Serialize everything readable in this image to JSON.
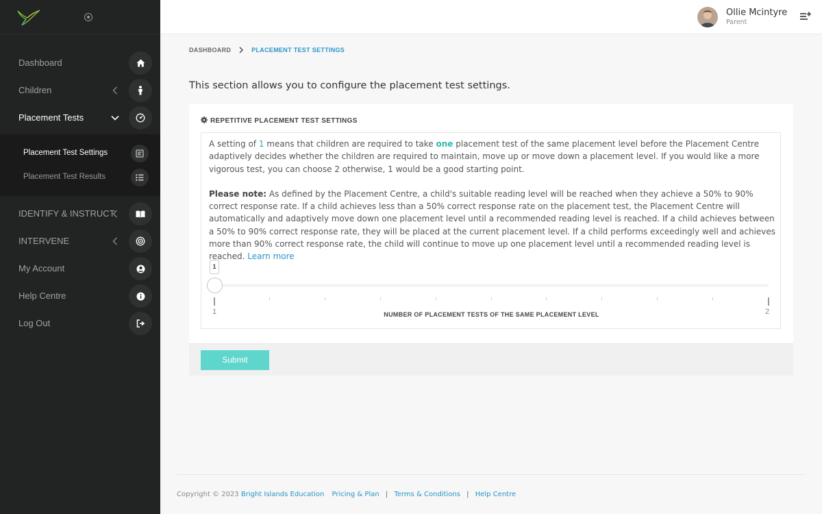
{
  "sidebar": {
    "nav": [
      {
        "label": "Dashboard",
        "icon": "home-icon"
      },
      {
        "label": "Children",
        "icon": "child-icon"
      },
      {
        "label": "Placement Tests",
        "icon": "gauge-icon"
      },
      {
        "label": "IDENTIFY & INSTRUCT",
        "icon": "book-icon"
      },
      {
        "label": "INTERVENE",
        "icon": "target-icon"
      },
      {
        "label": "My Account",
        "icon": "user-icon"
      },
      {
        "label": "Help Centre",
        "icon": "info-icon"
      },
      {
        "label": "Log Out",
        "icon": "logout-icon"
      }
    ],
    "submenu": [
      {
        "label": "Placement Test Settings",
        "icon": "form-icon"
      },
      {
        "label": "Placement Test Results",
        "icon": "list-icon"
      }
    ]
  },
  "header": {
    "user_name": "Ollie Mcintyre",
    "user_role": "Parent"
  },
  "breadcrumb": {
    "home": "DASHBOARD",
    "current": "PLACEMENT TEST SETTINGS"
  },
  "intro": "This section allows you to configure the placement test settings.",
  "card": {
    "title": "REPETITIVE PLACEMENT TEST SETTINGS",
    "p1": {
      "a": "A setting of ",
      "num": "1",
      "b": " means that children are required to take ",
      "hl": "one",
      "c": " placement test of the same placement level before the Placement Centre adaptively decides whether the children are required to maintain, move up or move down a placement level. If you would like a more vigorous test, you can choose 2 otherwise, 1 would be a good starting point."
    },
    "p2": {
      "bold": "Please note:",
      "text": " As defined by the Placement Centre, a child's suitable reading level will be reached when they achieve a 50% to 90% correct response rate. If a child achieves less than a 50% correct response rate on the placement test, the Placement Centre will automatically and adaptively move down one placement level until a recommended reading level is reached. If a child achieves between a 50% to 90% correct response rate, they will be placed at the current placement level. If a child performs exceedingly well and achieves more than 90% correct response rate, the child will continue to move up one placement level until a recommended reading level is reached. ",
      "link": "Learn more"
    },
    "slider": {
      "value": "1",
      "min": "1",
      "max": "2",
      "caption": "NUMBER OF PLACEMENT TESTS OF THE SAME PLACEMENT LEVEL"
    },
    "submit_label": "Submit"
  },
  "footer": {
    "copyright": "Copyright © 2023",
    "company": "Bright Islands Education",
    "links": [
      "Pricing & Plan",
      "Terms & Conditions",
      "Help Centre"
    ],
    "separator": "|"
  },
  "colors": {
    "sidebar_bg": "#222323",
    "accent": "#2a94c8",
    "submit": "#5ed6cc"
  }
}
